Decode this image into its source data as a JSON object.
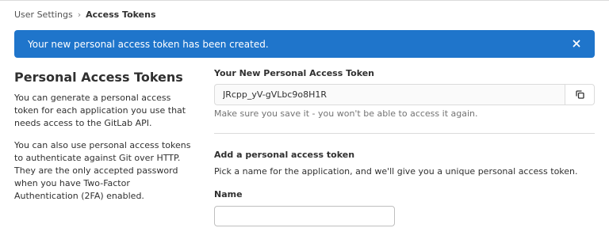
{
  "breadcrumb": {
    "parent": "User Settings",
    "separator": "›",
    "current": "Access Tokens"
  },
  "alert": {
    "message": "Your new personal access token has been created.",
    "close_icon": "close-icon",
    "color": "#1f75cb"
  },
  "sidebar": {
    "title": "Personal Access Tokens",
    "paragraph_1": "You can generate a personal access token for each application you use that needs access to the GitLab API.",
    "paragraph_2": "You can also use personal access tokens to authenticate against Git over HTTP. They are the only accepted password when you have Two-Factor Authentication (2FA) enabled."
  },
  "new_token": {
    "label": "Your New Personal Access Token",
    "value": "JRcpp_yV-gVLbc9o8H1R",
    "copy_icon": "copy-icon",
    "help": "Make sure you save it - you won't be able to access it again."
  },
  "add_token": {
    "title": "Add a personal access token",
    "description": "Pick a name for the application, and we'll give you a unique personal access token.",
    "name_label": "Name",
    "name_value": ""
  }
}
